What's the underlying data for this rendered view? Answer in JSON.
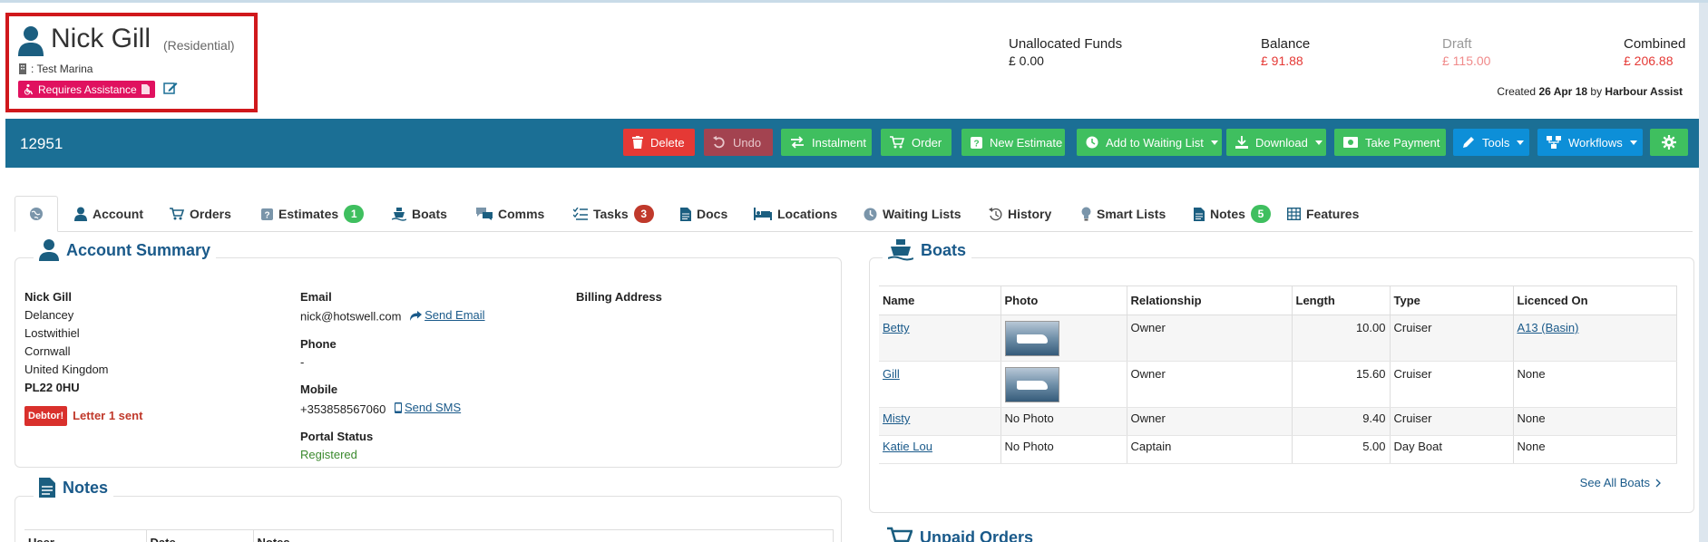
{
  "header": {
    "customer_name": "Nick Gill",
    "customer_type": "(Residential)",
    "marina": ": Test Marina",
    "assist_badge": "Requires Assistance",
    "funds": [
      {
        "label": "Unallocated Funds",
        "value": "£ 0.00",
        "color": "#222222"
      },
      {
        "label": "Balance",
        "value": "£ 91.88",
        "color": "#e53935"
      },
      {
        "label": "Draft",
        "value": "£ 115.00",
        "color": "#f08a8a",
        "label_color": "#999999"
      },
      {
        "label": "Combined",
        "value": "£ 206.88",
        "color": "#e53935"
      }
    ],
    "created_prefix": "Created",
    "created_date": "26 Apr 18",
    "created_by_prefix": "by",
    "created_by": "Harbour Assist"
  },
  "toolbar": {
    "account_number": "12951",
    "buttons": {
      "delete": "Delete",
      "undo": "Undo",
      "instalment": "Instalment",
      "order": "Order",
      "new_estimate": "New Estimate",
      "waiting_list": "Add to Waiting List",
      "download": "Download",
      "take_payment": "Take Payment",
      "tools": "Tools",
      "workflows": "Workflows"
    }
  },
  "tabs": {
    "account": "Account",
    "orders": "Orders",
    "estimates": "Estimates",
    "estimates_count": "1",
    "boats": "Boats",
    "comms": "Comms",
    "tasks": "Tasks",
    "tasks_count": "3",
    "docs": "Docs",
    "locations": "Locations",
    "waiting_lists": "Waiting Lists",
    "history": "History",
    "smart_lists": "Smart Lists",
    "notes": "Notes",
    "notes_count": "5",
    "features": "Features"
  },
  "account_summary": {
    "title": "Account Summary",
    "name": "Nick Gill",
    "address_lines": [
      "Delancey",
      "Lostwithiel",
      "Cornwall",
      "United Kingdom"
    ],
    "postcode": "PL22 0HU",
    "debtor_badge": "Debtor!",
    "debtor_text": "Letter 1 sent",
    "email_label": "Email",
    "email": "nick@hotswell.com",
    "send_email": "Send Email",
    "phone_label": "Phone",
    "phone": "-",
    "mobile_label": "Mobile",
    "mobile": "+353858567060",
    "send_sms": "Send SMS",
    "portal_label": "Portal Status",
    "portal_status": "Registered",
    "billing_label": "Billing Address"
  },
  "notes_panel": {
    "title": "Notes",
    "columns": [
      "User",
      "Date",
      "Notes"
    ]
  },
  "boats_panel": {
    "title": "Boats",
    "columns": [
      "Name",
      "Photo",
      "Relationship",
      "Length",
      "Type",
      "Licenced On"
    ],
    "rows": [
      {
        "name": "Betty",
        "photo": "",
        "relationship": "Owner",
        "length": "10.00",
        "type": "Cruiser",
        "licenced_on": "A13 (Basin)"
      },
      {
        "name": "Gill",
        "photo": "",
        "relationship": "Owner",
        "length": "15.60",
        "type": "Cruiser",
        "licenced_on": "None"
      },
      {
        "name": "Misty",
        "photo": "No Photo",
        "relationship": "Owner",
        "length": "9.40",
        "type": "Cruiser",
        "licenced_on": "None"
      },
      {
        "name": "Katie Lou",
        "photo": "No Photo",
        "relationship": "Captain",
        "length": "5.00",
        "type": "Day Boat",
        "licenced_on": "None"
      }
    ],
    "see_all": "See All Boats"
  },
  "unpaid_orders": {
    "title": "Unpaid Orders"
  }
}
